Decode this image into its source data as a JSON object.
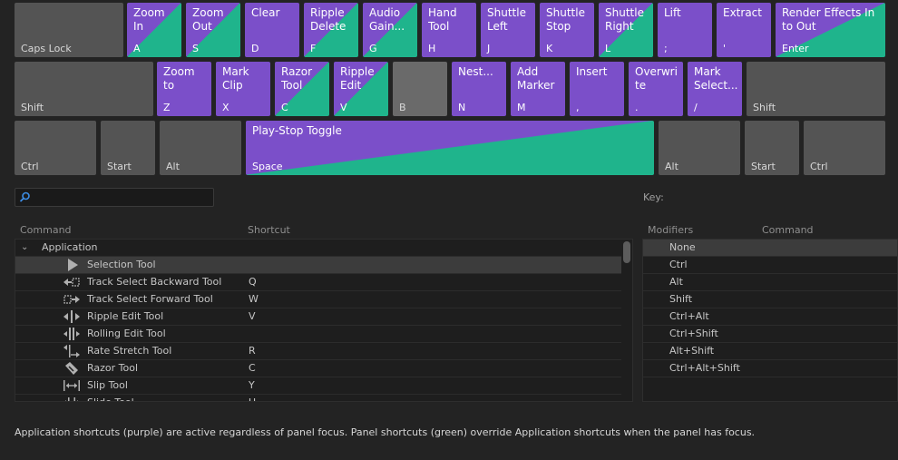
{
  "colors": {
    "application": "#7b4fc9",
    "panel": "#1fb48c",
    "unassigned": "#4f4f4f"
  },
  "keyboard": {
    "row1": [
      {
        "letter": "Caps Lock",
        "name": "",
        "style": "gray"
      },
      {
        "letter": "A",
        "name": "Zoom In",
        "style": "split"
      },
      {
        "letter": "S",
        "name": "Zoom Out",
        "style": "split"
      },
      {
        "letter": "D",
        "name": "Clear",
        "style": "purple"
      },
      {
        "letter": "F",
        "name": "Ripple Delete",
        "style": "split"
      },
      {
        "letter": "G",
        "name": "Audio Gain...",
        "style": "split"
      },
      {
        "letter": "H",
        "name": "Hand Tool",
        "style": "purple"
      },
      {
        "letter": "J",
        "name": "Shuttle Left",
        "style": "purple"
      },
      {
        "letter": "K",
        "name": "Shuttle Stop",
        "style": "purple"
      },
      {
        "letter": "L",
        "name": "Shuttle Right",
        "style": "split"
      },
      {
        "letter": ";",
        "name": "Lift",
        "style": "purple"
      },
      {
        "letter": "'",
        "name": "Extract",
        "style": "purple"
      },
      {
        "letter": "Enter",
        "name": "Render Effects In to Out",
        "style": "split"
      }
    ],
    "row2": [
      {
        "letter": "Shift",
        "name": "",
        "style": "gray"
      },
      {
        "letter": "Z",
        "name": "Zoom to Seque...",
        "style": "purple"
      },
      {
        "letter": "X",
        "name": "Mark Clip",
        "style": "purple"
      },
      {
        "letter": "C",
        "name": "Razor Tool",
        "style": "split"
      },
      {
        "letter": "V",
        "name": "Ripple Edit Tool",
        "style": "split"
      },
      {
        "letter": "B",
        "name": "",
        "style": "dim"
      },
      {
        "letter": "N",
        "name": "Nest...",
        "style": "purple"
      },
      {
        "letter": "M",
        "name": "Add Marker",
        "style": "purple"
      },
      {
        "letter": ",",
        "name": "Insert",
        "style": "purple"
      },
      {
        "letter": ".",
        "name": "Overwrite",
        "style": "purple"
      },
      {
        "letter": "/",
        "name": "Mark Select...",
        "style": "purple"
      },
      {
        "letter": "Shift",
        "name": "",
        "style": "gray"
      }
    ],
    "row3": [
      {
        "letter": "Ctrl",
        "name": "",
        "style": "gray"
      },
      {
        "letter": "Start",
        "name": "",
        "style": "gray"
      },
      {
        "letter": "Alt",
        "name": "",
        "style": "gray"
      },
      {
        "letter": "Space",
        "name": "Play-Stop Toggle",
        "style": "split"
      },
      {
        "letter": "Alt",
        "name": "",
        "style": "gray"
      },
      {
        "letter": "Start",
        "name": "",
        "style": "gray"
      },
      {
        "letter": "Ctrl",
        "name": "",
        "style": "gray"
      }
    ]
  },
  "search": {
    "placeholder": "",
    "value": ""
  },
  "key_label": "Key:",
  "commands": {
    "headers": {
      "command": "Command",
      "shortcut": "Shortcut"
    },
    "group": "Application",
    "rows": [
      {
        "icon": "selection-tool-icon",
        "label": "Selection Tool",
        "shortcut": ""
      },
      {
        "icon": "track-select-backward-icon",
        "label": "Track Select Backward Tool",
        "shortcut": "Q"
      },
      {
        "icon": "track-select-forward-icon",
        "label": "Track Select Forward Tool",
        "shortcut": "W"
      },
      {
        "icon": "ripple-edit-icon",
        "label": "Ripple Edit Tool",
        "shortcut": "V"
      },
      {
        "icon": "rolling-edit-icon",
        "label": "Rolling Edit Tool",
        "shortcut": ""
      },
      {
        "icon": "rate-stretch-icon",
        "label": "Rate Stretch Tool",
        "shortcut": "R"
      },
      {
        "icon": "razor-icon",
        "label": "Razor Tool",
        "shortcut": "C"
      },
      {
        "icon": "slip-icon",
        "label": "Slip Tool",
        "shortcut": "Y"
      },
      {
        "icon": "slide-icon",
        "label": "Slide Tool",
        "shortcut": "U"
      }
    ]
  },
  "modifiers": {
    "headers": {
      "modifiers": "Modifiers",
      "command": "Command"
    },
    "rows": [
      "None",
      "Ctrl",
      "Alt",
      "Shift",
      "Ctrl+Alt",
      "Ctrl+Shift",
      "Alt+Shift",
      "Ctrl+Alt+Shift"
    ]
  },
  "footer": "Application shortcuts (purple) are active regardless of panel focus. Panel shortcuts (green) override Application shortcuts when the panel has focus."
}
